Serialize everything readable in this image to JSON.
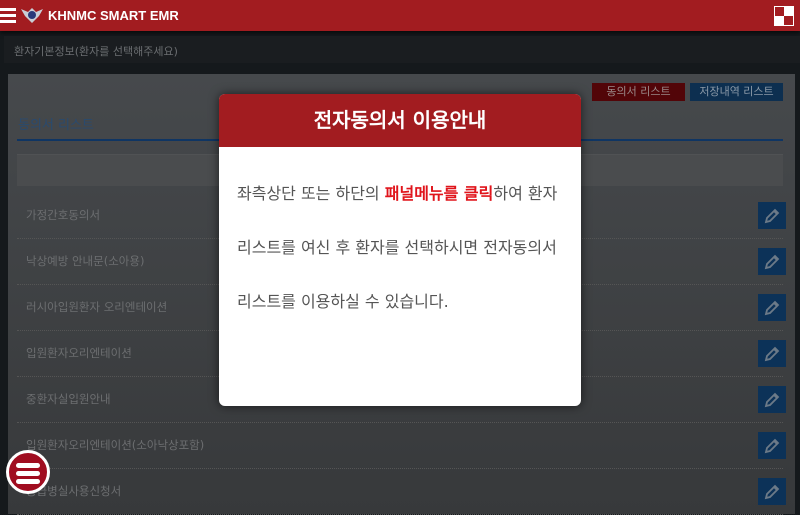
{
  "app": {
    "title": "KHNMC SMART EMR"
  },
  "patient_info": "환자기본정보(환자를 선택해주세요)",
  "buttons": {
    "consent_list": "동의서 리스트",
    "saved_list": "저장내역 리스트"
  },
  "section_title": "동의서 리스트",
  "rows": [
    {
      "label": "가정간호동의서"
    },
    {
      "label": "낙상예방 안내문(소아용)"
    },
    {
      "label": "러시아입원환자 오리엔테이션"
    },
    {
      "label": "입원환자오리엔테이션"
    },
    {
      "label": "중환자실입원안내"
    },
    {
      "label": "입원환자오리엔테이션(소아낙상포함)"
    },
    {
      "label": "응급병실사용신청서"
    }
  ],
  "modal": {
    "title": "전자동의서 이용안내",
    "text_before": "좌측상단 또는 하단의 ",
    "highlight": "패널메뉴를 클릭",
    "text_after": "하여 환자리스트를 여신 후 환자를 선택하시면 전자동의서 리스트를 이용하실 수 있습니다."
  },
  "colors": {
    "brand": "#a21c20",
    "highlight": "#e0141b"
  }
}
